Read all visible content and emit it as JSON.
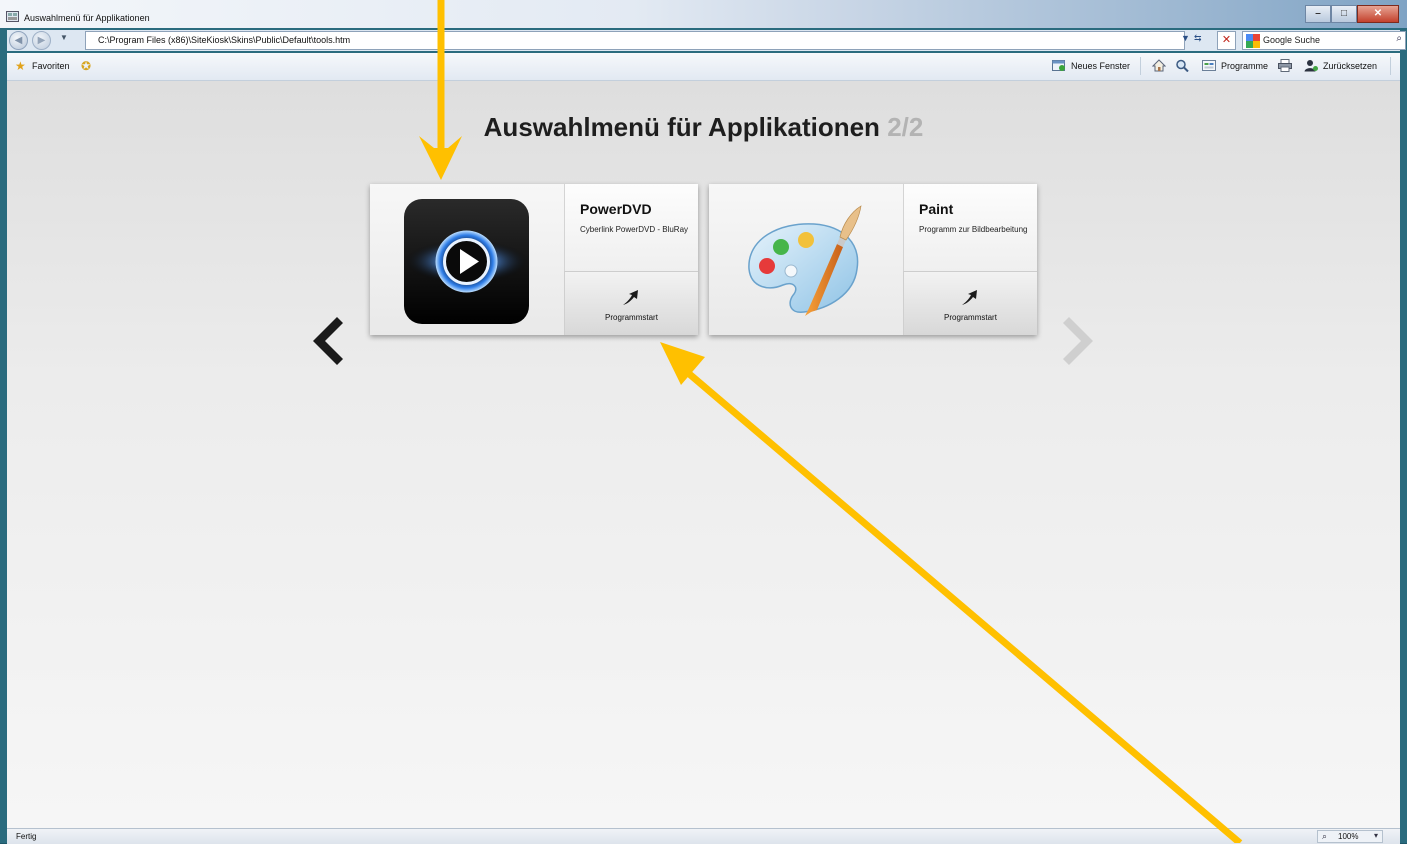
{
  "window": {
    "title": "Auswahlmenü für Applikationen",
    "controls": {
      "minimize": "–",
      "maximize": "□",
      "close": "✕"
    }
  },
  "address_bar": {
    "url": "C:\\Program Files (x86)\\SiteKiosk\\Skins\\Public\\Default\\tools.htm",
    "search_placeholder": "Google Suche"
  },
  "favorites_bar": {
    "favorites_label": "Favoriten",
    "toolbar": {
      "new_window": "Neues Fenster",
      "programs": "Programme",
      "reset": "Zurücksetzen"
    }
  },
  "page": {
    "heading": "Auswahlmenü für Applikationen",
    "page_indicator": "2/2",
    "cards": [
      {
        "name": "PowerDVD",
        "description": "Cyberlink PowerDVD - BluRay",
        "start_label": "Programmstart",
        "icon": "powerdvd-icon"
      },
      {
        "name": "Paint",
        "description": "Programm zur Bildbearbeitung",
        "start_label": "Programmstart",
        "icon": "paint-palette-icon"
      }
    ]
  },
  "status_bar": {
    "status": "Fertig",
    "zoom": "100%"
  },
  "colors": {
    "annotation_arrow": "#ffc000",
    "heading_text": "#1e1e1e",
    "page_indicator": "#b3b3b3"
  }
}
